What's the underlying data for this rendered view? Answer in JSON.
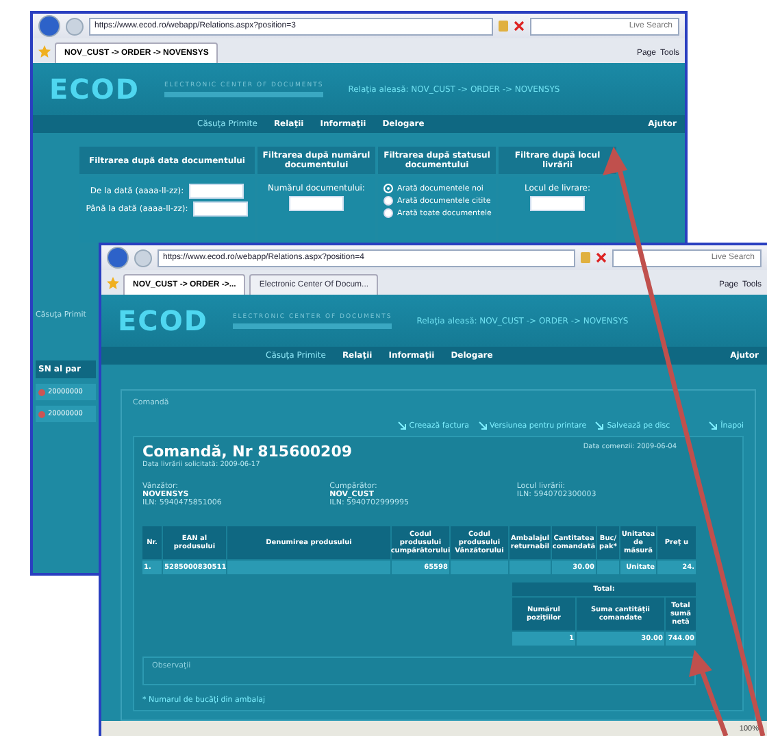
{
  "windows": [
    {
      "kind": "filters",
      "address": "https://www.ecod.ro/webapp/Relations.aspx?position=3",
      "search_placeholder": "Live Search",
      "tabs": [
        {
          "label": "NOV_CUST -> ORDER -> NOVENSYS",
          "selected": true
        }
      ],
      "toolbar": [
        "Page",
        "Tools"
      ],
      "site": {
        "logo": "ECOD",
        "tagline": "ELECTRONIC CENTER OF DOCUMENTS",
        "breadcrumb": "Relaţia aleasă: NOV_CUST -> ORDER -> NOVENSYS",
        "nav": [
          "Căsuţa Primite",
          "Relaţii",
          "Informaţii",
          "Delogare"
        ],
        "help": "Ajutor"
      },
      "filters": [
        {
          "title": "Filtrarea după data documentului",
          "fields": [
            {
              "kind": "text",
              "label": "De la dată (aaaa-ll-zz):"
            },
            {
              "kind": "text",
              "label": "Până la dată (aaaa-ll-zz):"
            }
          ]
        },
        {
          "title": "Filtrarea după numărul documentului",
          "fields": [
            {
              "kind": "stacked",
              "label": "Numărul documentului:"
            }
          ]
        },
        {
          "title": "Filtrarea după statusul documentului",
          "fields": [
            {
              "kind": "radio",
              "label": "Arată documentele noi",
              "selected": true
            },
            {
              "kind": "radio",
              "label": "Arată documentele citite",
              "selected": false
            },
            {
              "kind": "radio",
              "label": "Arată toate documentele",
              "selected": false
            }
          ]
        },
        {
          "title": "Filtrare după locul livrării",
          "fields": [
            {
              "kind": "stacked",
              "label": "Locul de livrare:"
            }
          ]
        }
      ],
      "inbox": {
        "title": "Căsuţa Primit",
        "column": "SN al par",
        "rows": [
          "20000000",
          "20000000"
        ]
      }
    },
    {
      "kind": "order",
      "address": "https://www.ecod.ro/webapp/Relations.aspx?position=4",
      "search_placeholder": "Live Search",
      "tabs": [
        {
          "label": "NOV_CUST -> ORDER ->...",
          "selected": true
        },
        {
          "label": "Electronic Center Of Docum...",
          "selected": false
        }
      ],
      "toolbar": [
        "Page",
        "Tools"
      ],
      "site": {
        "logo": "ECOD",
        "tagline": "ELECTRONIC CENTER OF DOCUMENTS",
        "breadcrumb": "Relaţia aleasă: NOV_CUST -> ORDER -> NOVENSYS",
        "nav": [
          "Căsuţa Primite",
          "Relaţii",
          "Informaţii",
          "Delogare"
        ],
        "help": "Ajutor"
      },
      "section": "Comandă",
      "actions": [
        "Creează factura",
        "Versiunea pentru printare",
        "Salvează pe disc",
        "Înapoi"
      ],
      "order": {
        "title": "Comandă, Nr 815600209",
        "delivery": "Data livrării solicitată: 2009-06-17",
        "date": "Data comenzii: 2009-06-04",
        "parties": [
          {
            "label": "Vânzător:",
            "name": "NOVENSYS",
            "iln": "ILN: 5940475851006"
          },
          {
            "label": "Cumpărător:",
            "name": "NOV_CUST",
            "iln": "ILN: 5940702999995"
          },
          {
            "label": "Locul livrării:",
            "iln": "ILN: 5940702300003"
          }
        ],
        "columns": [
          "Nr.",
          "EAN al produsului",
          "Denumirea produsului",
          "Codul produsului cumpărătorului",
          "Codul produsului Vânzătorului",
          "Ambalajul returnabil",
          "Cantitatea comandată",
          "Buc/ pak*",
          "Unitatea de măsură",
          "Preţ u"
        ],
        "rows": [
          [
            "1.",
            "5285000830511",
            "",
            "65598",
            "",
            "",
            "30.00",
            "",
            "Unitate",
            "24."
          ]
        ],
        "total": {
          "title": "Total:",
          "columns": [
            "Numărul poziţiilor",
            "Suma cantităţii comandate",
            "Total sumă netă"
          ],
          "values": [
            "1",
            "30.00",
            "744.00"
          ]
        },
        "notes": "Observaţii",
        "footnote": "* Numarul de bucăţi din ambalaj"
      },
      "status_bar": {
        "zoom": "100%"
      }
    }
  ]
}
